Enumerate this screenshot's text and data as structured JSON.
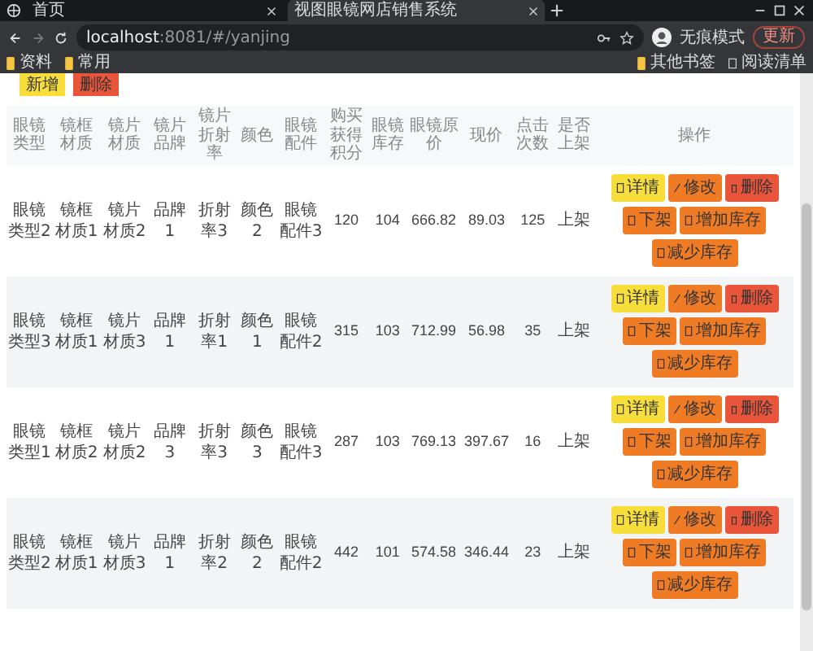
{
  "browser": {
    "tabs": [
      {
        "title": "首页",
        "selected": false
      },
      {
        "title": "视图眼镜网店销售系统",
        "selected": true
      }
    ],
    "address": {
      "host": "localhost",
      "path": ":8081/#/yanjing"
    },
    "profile": "无痕模式",
    "update_button": "更新",
    "bookmarks": [
      "资料",
      "常用"
    ],
    "bookmarks_right": [
      {
        "label": "其他书签",
        "kind": "folder"
      },
      {
        "label": "阅读清单",
        "kind": "list"
      }
    ]
  },
  "toolbar": [
    {
      "label": "新增",
      "kind": "add"
    },
    {
      "label": "删除",
      "kind": "delete"
    }
  ],
  "table": {
    "columns": [
      "眼镜类型",
      "镜框材质",
      "镜片材质",
      "镜片品牌",
      "镜片折射率",
      "颜色",
      "眼镜配件",
      "购买获得积分",
      "眼镜库存",
      "眼镜原价",
      "现价",
      "点击次数",
      "是否上架",
      "操作"
    ],
    "rows": [
      {
        "cells": [
          "眼镜类型2",
          "镜框材质1",
          "镜片材质2",
          "品牌1",
          "折射率3",
          "颜色2",
          "眼镜配件3",
          "120",
          "104",
          "666.82",
          "89.03",
          "125",
          "上架"
        ],
        "actions": [
          {
            "label": "详情",
            "kind": "detail"
          },
          {
            "label": "修改",
            "kind": "edit"
          },
          {
            "label": "删除",
            "kind": "delete"
          },
          {
            "label": "下架",
            "kind": "offshelf"
          },
          {
            "label": "增加库存",
            "kind": "stock"
          },
          {
            "label": "减少库存",
            "kind": "stock"
          }
        ]
      },
      {
        "cells": [
          "眼镜类型3",
          "镜框材质1",
          "镜片材质3",
          "品牌1",
          "折射率1",
          "颜色1",
          "眼镜配件2",
          "315",
          "103",
          "712.99",
          "56.98",
          "35",
          "上架"
        ],
        "actions": [
          {
            "label": "详情",
            "kind": "detail"
          },
          {
            "label": "修改",
            "kind": "edit"
          },
          {
            "label": "删除",
            "kind": "delete"
          },
          {
            "label": "下架",
            "kind": "offshelf"
          },
          {
            "label": "增加库存",
            "kind": "stock"
          },
          {
            "label": "减少库存",
            "kind": "stock"
          }
        ]
      },
      {
        "cells": [
          "眼镜类型1",
          "镜框材质2",
          "镜片材质2",
          "品牌3",
          "折射率3",
          "颜色3",
          "眼镜配件3",
          "287",
          "103",
          "769.13",
          "397.67",
          "16",
          "上架"
        ],
        "actions": [
          {
            "label": "详情",
            "kind": "detail"
          },
          {
            "label": "修改",
            "kind": "edit"
          },
          {
            "label": "删除",
            "kind": "delete"
          },
          {
            "label": "下架",
            "kind": "offshelf"
          },
          {
            "label": "增加库存",
            "kind": "stock"
          },
          {
            "label": "减少库存",
            "kind": "stock"
          }
        ]
      },
      {
        "cells": [
          "眼镜类型2",
          "镜框材质1",
          "镜片材质3",
          "品牌1",
          "折射率2",
          "颜色2",
          "眼镜配件2",
          "442",
          "101",
          "574.58",
          "346.44",
          "23",
          "上架"
        ],
        "actions": [
          {
            "label": "详情",
            "kind": "detail"
          },
          {
            "label": "修改",
            "kind": "edit"
          },
          {
            "label": "删除",
            "kind": "delete"
          },
          {
            "label": "下架",
            "kind": "offshelf"
          },
          {
            "label": "增加库存",
            "kind": "stock"
          },
          {
            "label": "减少库存",
            "kind": "stock"
          }
        ]
      }
    ]
  }
}
